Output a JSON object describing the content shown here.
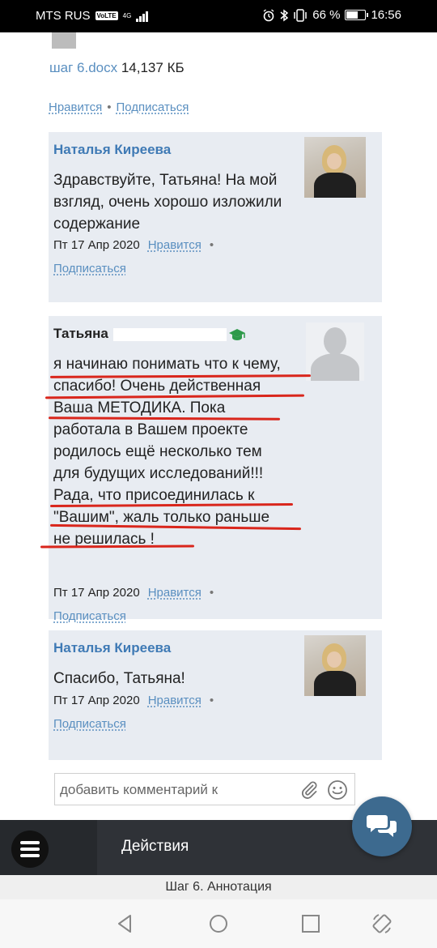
{
  "status_bar": {
    "carrier": "MTS RUS",
    "volte": "VoLTE",
    "network": "4G",
    "battery_percent": "66 %",
    "battery_level": 0.66,
    "time": "16:56"
  },
  "attachment": {
    "file_name": "шаг 6.docx",
    "file_size": "14,137 КБ"
  },
  "post_actions": {
    "like": "Нравится",
    "subscribe": "Подписаться"
  },
  "comments": [
    {
      "author": "Наталья Киреева",
      "lines": [
        "Здравствуйте, Татьяна! На мой",
        "взгляд, очень хорошо изложили",
        "содержание"
      ],
      "date": "Пт 17 Апр 2020",
      "like": "Нравится",
      "subscribe": "Подписаться"
    },
    {
      "author": "Татьяна",
      "lines": [
        "я начинаю понимать что к чему,",
        "спасибо! Очень действенная",
        "Ваша МЕТОДИКА. Пока",
        "работала в Вашем проекте",
        "родилось ещё несколько тем",
        "для будущих исследований!!!",
        "Рада, что присоединилась к",
        "\"Вашим\", жаль только раньше",
        "не решилась !"
      ],
      "date": "Пт 17 Апр 2020",
      "like": "Нравится",
      "subscribe": "Подписаться"
    },
    {
      "author": "Наталья Киреева",
      "lines": [
        "Спасибо, Татьяна!"
      ],
      "date": "Пт 17 Апр 2020",
      "like": "Нравится",
      "subscribe": "Подписаться"
    }
  ],
  "comment_input": {
    "placeholder": "добавить комментарий к"
  },
  "bottom_bar": {
    "actions_label": "Действия"
  },
  "page_title": "Шаг 6. Аннотация",
  "colors": {
    "link": "#5a8fc0",
    "author": "#3f7ab5",
    "card_bg": "#e8ecf2",
    "bar": "#2f3237",
    "fab": "#3d6a8f",
    "annotation": "#d9261c"
  },
  "icons": [
    "alarm-icon",
    "bluetooth-icon",
    "vibrate-icon",
    "battery-icon",
    "graduation-cap-icon",
    "paperclip-icon",
    "smile-icon",
    "menu-icon",
    "chat-icon",
    "back-icon",
    "home-icon",
    "recents-icon",
    "rotate-icon"
  ]
}
